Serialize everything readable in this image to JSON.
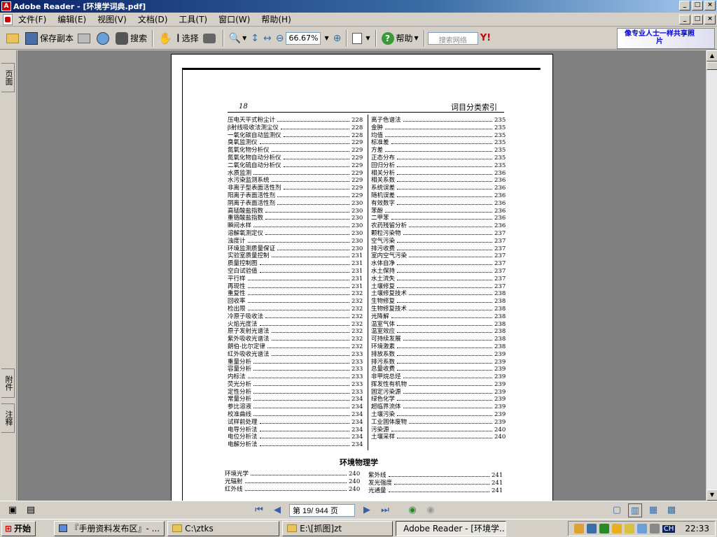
{
  "window": {
    "title": "Adobe Reader - [环境学词典.pdf]"
  },
  "menu": [
    "文件(F)",
    "编辑(E)",
    "视图(V)",
    "文档(D)",
    "工具(T)",
    "窗口(W)",
    "帮助(H)"
  ],
  "toolbar": {
    "save_label": "保存副本",
    "search_label": "搜索",
    "select_label": "选择",
    "zoom_value": "66.67%",
    "help_label": "帮助",
    "web_search_placeholder": "搜索网络",
    "ad_text": "像专业人士一样共享照片"
  },
  "left_tabs": [
    "页面",
    "附件",
    "注释"
  ],
  "document": {
    "page_number": "18",
    "page_header": "词目分类索引",
    "left_column": [
      {
        "term": "压电天平式粉尘计",
        "page": "228"
      },
      {
        "term": "β射线吸收法测尘仪",
        "page": "228"
      },
      {
        "term": "一氧化碳自动监测仪",
        "page": "228"
      },
      {
        "term": "臭氧监测仪",
        "page": "229"
      },
      {
        "term": "氮氧化物分析仪",
        "page": "229"
      },
      {
        "term": "氮氧化物自动分析仪",
        "page": "229"
      },
      {
        "term": "二氧化硫自动分析仪",
        "page": "229"
      },
      {
        "term": "水质监测",
        "page": "229"
      },
      {
        "term": "水污染监测系统",
        "page": "229"
      },
      {
        "term": "非离子型表面活性剂",
        "page": "229"
      },
      {
        "term": "阳离子表面活性剂",
        "page": "229"
      },
      {
        "term": "阴离子表面活性剂",
        "page": "230"
      },
      {
        "term": "高锰酸盐指数",
        "page": "230"
      },
      {
        "term": "重铬酸盐指数",
        "page": "230"
      },
      {
        "term": "瞬间水样",
        "page": "230"
      },
      {
        "term": "溶解氧测定仪",
        "page": "230"
      },
      {
        "term": "浊度计",
        "page": "230"
      },
      {
        "term": "环境监测质量保证",
        "page": "230"
      },
      {
        "term": "实验室质量控制",
        "page": "231"
      },
      {
        "term": "质量控制图",
        "page": "231"
      },
      {
        "term": "空白试验值",
        "page": "231"
      },
      {
        "term": "平行样",
        "page": "231"
      },
      {
        "term": "再现性",
        "page": "231"
      },
      {
        "term": "重复性",
        "page": "232"
      },
      {
        "term": "回收率",
        "page": "232"
      },
      {
        "term": "检出限",
        "page": "232"
      },
      {
        "term": "冷原子吸收法",
        "page": "232"
      },
      {
        "term": "火焰光度法",
        "page": "232"
      },
      {
        "term": "原子发射光谱法",
        "page": "232"
      },
      {
        "term": "紫外吸收光谱法",
        "page": "232"
      },
      {
        "term": "朗伯-比尔定律",
        "page": "232"
      },
      {
        "term": "红外吸收光谱法",
        "page": "233"
      },
      {
        "term": "重量分析",
        "page": "233"
      },
      {
        "term": "容量分析",
        "page": "233"
      },
      {
        "term": "内标法",
        "page": "233"
      },
      {
        "term": "荧光分析",
        "page": "233"
      },
      {
        "term": "定性分析",
        "page": "233"
      },
      {
        "term": "常量分析",
        "page": "234"
      },
      {
        "term": "参比溶液",
        "page": "234"
      },
      {
        "term": "校准曲线",
        "page": "234"
      },
      {
        "term": "试样前处理",
        "page": "234"
      },
      {
        "term": "电导分析法",
        "page": "234"
      },
      {
        "term": "电位分析法",
        "page": "234"
      },
      {
        "term": "电解分析法",
        "page": "234"
      }
    ],
    "right_column": [
      {
        "term": "离子色谱法",
        "page": "235"
      },
      {
        "term": "金肿",
        "page": "235"
      },
      {
        "term": "均值",
        "page": "235"
      },
      {
        "term": "标准差",
        "page": "235"
      },
      {
        "term": "方差",
        "page": "235"
      },
      {
        "term": "正态分布",
        "page": "235"
      },
      {
        "term": "回归分析",
        "page": "235"
      },
      {
        "term": "相关分析",
        "page": "236"
      },
      {
        "term": "相关系数",
        "page": "236"
      },
      {
        "term": "系统误差",
        "page": "236"
      },
      {
        "term": "随机误差",
        "page": "236"
      },
      {
        "term": "有效数字",
        "page": "236"
      },
      {
        "term": "苯酚",
        "page": "236"
      },
      {
        "term": "二甲苯",
        "page": "236"
      },
      {
        "term": "农药残留分析",
        "page": "236"
      },
      {
        "term": "颗粒污染物",
        "page": "237"
      },
      {
        "term": "空气污染",
        "page": "237"
      },
      {
        "term": "排污收费",
        "page": "237"
      },
      {
        "term": "室内空气污染",
        "page": "237"
      },
      {
        "term": "水体自净",
        "page": "237"
      },
      {
        "term": "水土保持",
        "page": "237"
      },
      {
        "term": "水土流失",
        "page": "237"
      },
      {
        "term": "土壤修复",
        "page": "237"
      },
      {
        "term": "土壤修复技术",
        "page": "238"
      },
      {
        "term": "生物修复",
        "page": "238"
      },
      {
        "term": "生物修复技术",
        "page": "238"
      },
      {
        "term": "光降解",
        "page": "238"
      },
      {
        "term": "温室气体",
        "page": "238"
      },
      {
        "term": "温室效应",
        "page": "238"
      },
      {
        "term": "可持续发展",
        "page": "238"
      },
      {
        "term": "环境激素",
        "page": "238"
      },
      {
        "term": "排放系数",
        "page": "239"
      },
      {
        "term": "排污系数",
        "page": "239"
      },
      {
        "term": "总量收费",
        "page": "239"
      },
      {
        "term": "非甲烷总烃",
        "page": "239"
      },
      {
        "term": "挥发性有机物",
        "page": "239"
      },
      {
        "term": "固定污染源",
        "page": "239"
      },
      {
        "term": "绿色化学",
        "page": "239"
      },
      {
        "term": "超临界流体",
        "page": "239"
      },
      {
        "term": "土壤污染",
        "page": "239"
      },
      {
        "term": "工业固体废物",
        "page": "239"
      },
      {
        "term": "污染源",
        "page": "240"
      },
      {
        "term": "土壤采样",
        "page": "240"
      }
    ],
    "section_title": "环境物理学",
    "section_left": [
      {
        "term": "环境光学",
        "page": "240"
      },
      {
        "term": "光辐射",
        "page": "240"
      },
      {
        "term": "红外线",
        "page": "240"
      }
    ],
    "section_right": [
      {
        "term": "紫外线",
        "page": "241"
      },
      {
        "term": "发光强度",
        "page": "241"
      },
      {
        "term": "光通量",
        "page": "241"
      }
    ]
  },
  "status": {
    "page_field": "第 19/ 944 页"
  },
  "taskbar": {
    "start_label": "开始",
    "tasks": [
      "『手册资料发布区』- ...",
      "C:\\ztks",
      "E:\\[抓图]zt",
      "Adobe Reader - [环境学..."
    ],
    "clock": "22:33",
    "lang": "CH"
  }
}
